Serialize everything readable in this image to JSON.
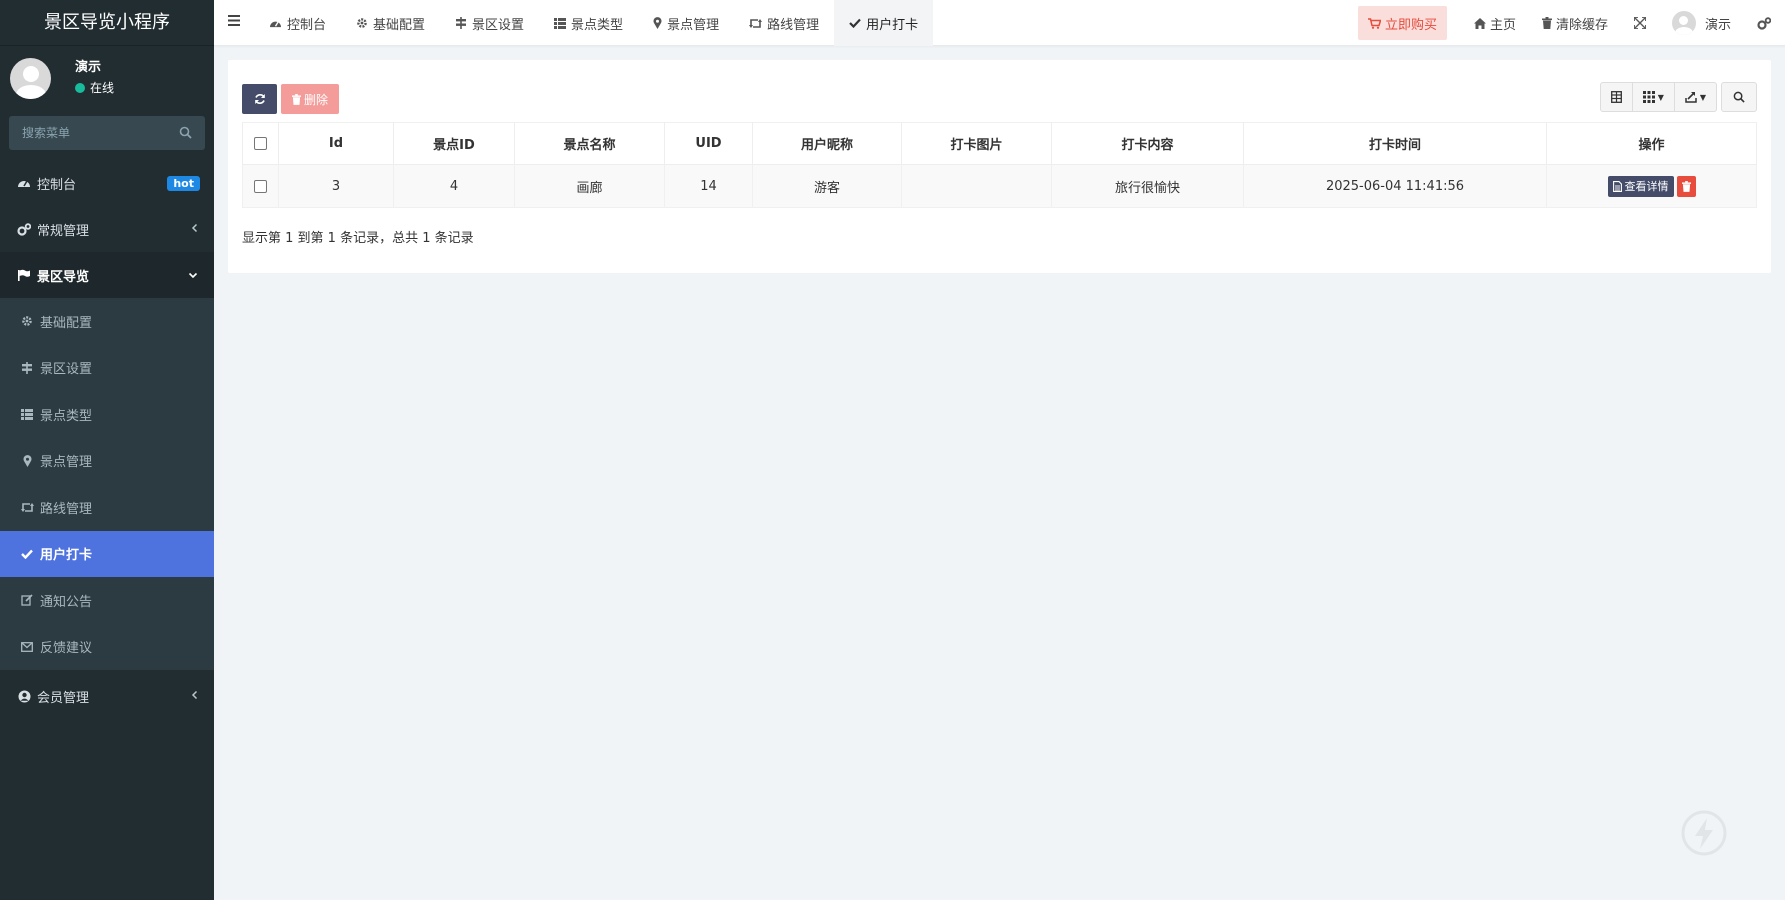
{
  "sidebar": {
    "brand": "景区导览小程序",
    "user": {
      "name": "演示",
      "status": "在线"
    },
    "search_placeholder": "搜索菜单",
    "items": [
      {
        "label": "控制台",
        "icon": "dashboard-icon",
        "badge": "hot"
      },
      {
        "label": "常规管理",
        "icon": "cogs-icon"
      },
      {
        "label": "景区导览",
        "icon": "flag-icon"
      }
    ],
    "subitems": [
      {
        "label": "基础配置",
        "icon": "gear-icon"
      },
      {
        "label": "景区设置",
        "icon": "signpost-icon"
      },
      {
        "label": "景点类型",
        "icon": "list-icon"
      },
      {
        "label": "景点管理",
        "icon": "map-marker-icon"
      },
      {
        "label": "路线管理",
        "icon": "retweet-icon"
      },
      {
        "label": "用户打卡",
        "icon": "check-icon"
      },
      {
        "label": "通知公告",
        "icon": "edit-icon"
      },
      {
        "label": "反馈建议",
        "icon": "envelope-icon"
      }
    ],
    "member": {
      "label": "会员管理",
      "icon": "user-circle-icon"
    }
  },
  "topbar": {
    "tabs": [
      {
        "label": "控制台",
        "icon": "dashboard-icon"
      },
      {
        "label": "基础配置",
        "icon": "gear-icon"
      },
      {
        "label": "景区设置",
        "icon": "signpost-icon"
      },
      {
        "label": "景点类型",
        "icon": "list-icon"
      },
      {
        "label": "景点管理",
        "icon": "map-marker-icon"
      },
      {
        "label": "路线管理",
        "icon": "retweet-icon"
      },
      {
        "label": "用户打卡",
        "icon": "check-icon"
      }
    ],
    "buy_label": "立即购买",
    "home_label": "主页",
    "clear_cache_label": "清除缓存",
    "user_label": "演示"
  },
  "toolbar": {
    "delete_label": "删除"
  },
  "table": {
    "columns": [
      "Id",
      "景点ID",
      "景点名称",
      "UID",
      "用户昵称",
      "打卡图片",
      "打卡内容",
      "打卡时间",
      "操作"
    ],
    "rows": [
      {
        "id": "3",
        "spot_id": "4",
        "spot_name": "画廊",
        "uid": "14",
        "nickname": "游客",
        "image": "",
        "content": "旅行很愉快",
        "time": "2025-06-04 11:41:56",
        "detail_label": "查看详情"
      }
    ]
  },
  "pagination": {
    "info": "显示第 1 到第 1 条记录，总共 1 条记录"
  },
  "colors": {
    "sidebar_bg": "#222d32",
    "active_bg": "#4e73df",
    "primary_dark": "#444c69",
    "danger": "#e74c3c",
    "success": "#18bc9c"
  }
}
